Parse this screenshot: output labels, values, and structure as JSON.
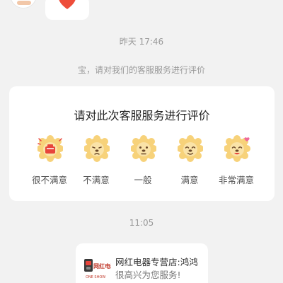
{
  "messages": {
    "time_1": "昨天 17:46",
    "system_prompt": "宝，请对我们的客服服务进行评价",
    "time_2": "11:05"
  },
  "rating_card": {
    "title": "请对此次客服服务进行评价",
    "options": [
      {
        "label": "很不满意",
        "icon": "very-dissatisfied-lion-icon"
      },
      {
        "label": "不满意",
        "icon": "dissatisfied-lion-icon"
      },
      {
        "label": "一般",
        "icon": "neutral-lion-icon"
      },
      {
        "label": "满意",
        "icon": "satisfied-lion-icon"
      },
      {
        "label": "非常满意",
        "icon": "very-satisfied-lion-icon"
      }
    ]
  },
  "shop_message": {
    "logo_text": "网红电器",
    "logo_subtext": "ONE SHOW",
    "name": "网红电器专营店:鸿鸿",
    "greeting": "很高兴为您服务!"
  },
  "colors": {
    "background": "#f2f2f2",
    "card": "#ffffff",
    "mascot": "#f7d27a",
    "heart": "#ee4d3a",
    "brand": "#c0392b"
  }
}
